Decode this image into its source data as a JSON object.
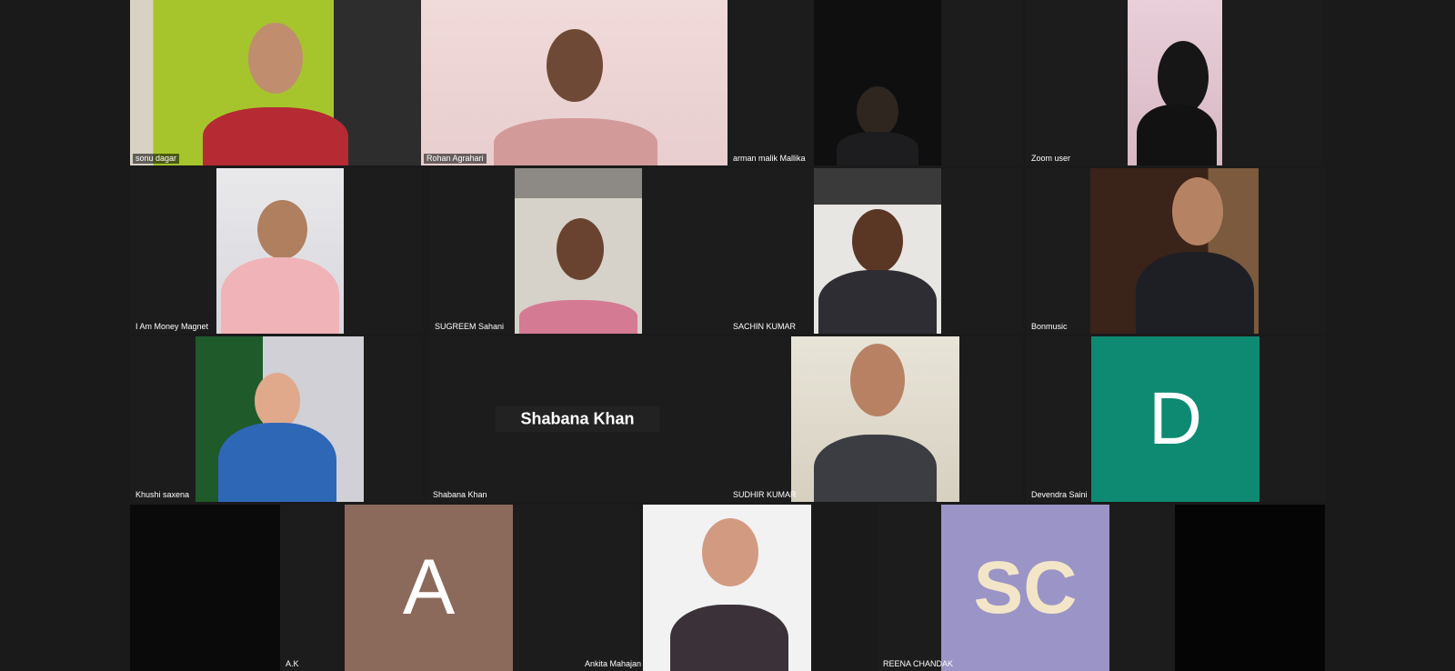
{
  "featured_speaker": "Shabana Khan",
  "participants": [
    {
      "name": "sonu dagar",
      "avatar_letter": "",
      "avatar_color": ""
    },
    {
      "name": "Rohan Agrahari",
      "avatar_letter": "",
      "avatar_color": ""
    },
    {
      "name": "arman malik Mallika",
      "avatar_letter": "",
      "avatar_color": ""
    },
    {
      "name": "Zoom user",
      "avatar_letter": "",
      "avatar_color": ""
    },
    {
      "name": "I Am Money Magnet",
      "avatar_letter": "",
      "avatar_color": ""
    },
    {
      "name": "SUGREEM Sahani",
      "avatar_letter": "",
      "avatar_color": ""
    },
    {
      "name": "SACHIN KUMAR",
      "avatar_letter": "",
      "avatar_color": ""
    },
    {
      "name": "Bonmusic",
      "avatar_letter": "",
      "avatar_color": ""
    },
    {
      "name": "Khushi saxena",
      "avatar_letter": "",
      "avatar_color": ""
    },
    {
      "name": "Shabana Khan",
      "avatar_letter": "",
      "avatar_color": ""
    },
    {
      "name": "SUDHIR KUMAR",
      "avatar_letter": "",
      "avatar_color": ""
    },
    {
      "name": "Devendra Saini",
      "avatar_letter": "D",
      "avatar_color": "#0e8a72"
    },
    {
      "name": "",
      "avatar_letter": "",
      "avatar_color": ""
    },
    {
      "name": "A.K",
      "avatar_letter": "A",
      "avatar_color": "#8b6a5c"
    },
    {
      "name": "Ankita Mahajan",
      "avatar_letter": "",
      "avatar_color": ""
    },
    {
      "name": "REENA CHANDAK",
      "avatar_letter": "SC",
      "avatar_color": "#9b94c6"
    }
  ],
  "colors": {
    "background": "#1a1a1a",
    "tile_background": "#1c1c1c",
    "avatar_text_sc": "#f3e6c8"
  }
}
